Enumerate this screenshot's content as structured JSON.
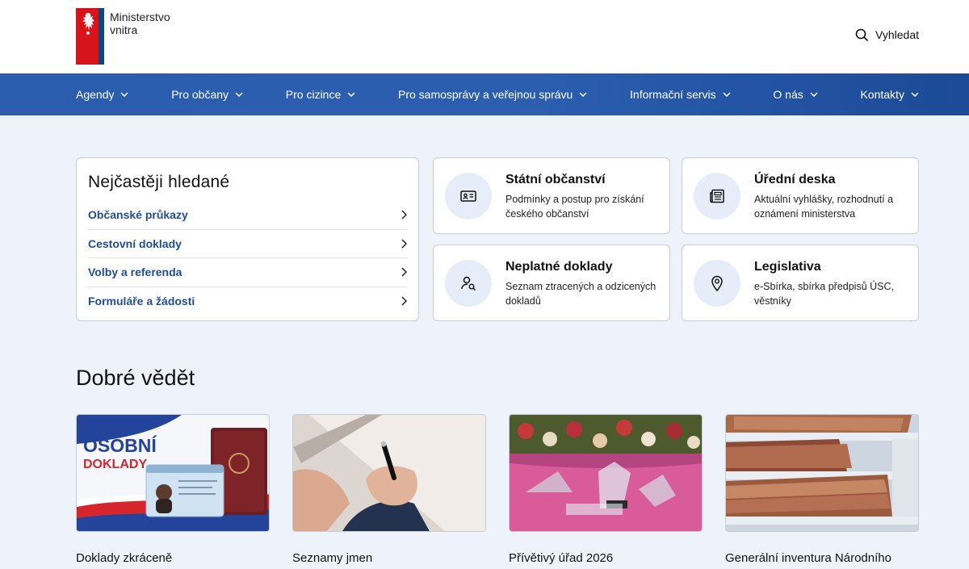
{
  "header": {
    "logo_line1": "Ministerstvo",
    "logo_line2": "vnitra",
    "search_label": "Vyhledat"
  },
  "nav": [
    {
      "label": "Agendy"
    },
    {
      "label": "Pro občany"
    },
    {
      "label": "Pro cizince"
    },
    {
      "label": "Pro samosprávy a veřejnou správu"
    },
    {
      "label": "Informační servis"
    },
    {
      "label": "O nás"
    },
    {
      "label": "Kontakty"
    }
  ],
  "frequent": {
    "title": "Nejčastěji hledané",
    "items": [
      {
        "label": "Občanské průkazy"
      },
      {
        "label": "Cestovní doklady"
      },
      {
        "label": "Volby a referenda"
      },
      {
        "label": "Formuláře a žádosti"
      }
    ]
  },
  "cards": [
    {
      "title": "Státní občanství",
      "desc": "Podmínky a postup pro získání českého občanství",
      "icon": "id-card-icon"
    },
    {
      "title": "Úřední deska",
      "desc": "Aktuální vyhlášky, rozhodnutí a oznámení ministerstva",
      "icon": "newspaper-icon"
    },
    {
      "title": "Neplatné doklady",
      "desc": "Seznam ztracených a odzicených dokladů",
      "icon": "user-search-icon"
    },
    {
      "title": "Legislativa",
      "desc": "e-Sbírka, sbírka předpisů ÚSC, věstníky",
      "icon": "map-pin-icon"
    }
  ],
  "good_to_know": {
    "title": "Dobré vědět",
    "tiles": [
      {
        "title": "Doklady zkráceně",
        "image_text_1": "OSOBNÍ",
        "image_text_2": "DOKLADY"
      },
      {
        "title": "Seznamy jmen"
      },
      {
        "title": "Přívětivý úřad 2026"
      },
      {
        "title": "Generální inventura Národního"
      }
    ]
  },
  "colors": {
    "brand_blue": "#2c5eb0",
    "link_blue": "#1f4d97",
    "band_bg": "#eef3fb",
    "flag_red": "#d7141a"
  }
}
